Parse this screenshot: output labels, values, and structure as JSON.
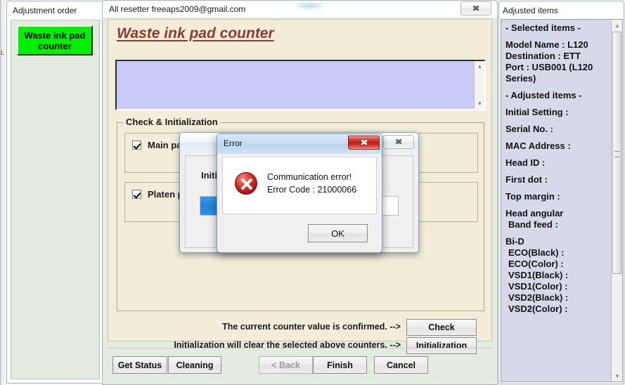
{
  "left_panel": {
    "title": "Adjustment order",
    "waste_button_label": "Waste ink pad counter",
    "waste_button_color": "#00f000",
    "edge_fragment": "L"
  },
  "main_window": {
    "title": "All resetter freeaps2009@gmail.com",
    "close_icon": "close-icon",
    "heading": "Waste ink pad counter",
    "heading_color": "#8f3b2e",
    "log_text": "",
    "group_label": "Check & Initialization",
    "checkboxes": [
      {
        "label": "Main pad counter",
        "checked": true
      },
      {
        "label": "Platen pad counter",
        "checked": true
      }
    ],
    "prompts": {
      "check": "The current counter value is confirmed. -->",
      "initialization": "Initialization will clear the selected above counters. -->"
    },
    "action_buttons": {
      "check": "Check",
      "initialization": "Initialization"
    },
    "footer_buttons": [
      {
        "label": "Get Status",
        "enabled": true
      },
      {
        "label": "Cleaning",
        "enabled": true
      },
      {
        "label": "< Back",
        "enabled": false
      },
      {
        "label": "Finish",
        "enabled": true
      },
      {
        "label": "Cancel",
        "enabled": true
      }
    ]
  },
  "init_dialog": {
    "text": "Initi",
    "close_icon": "close-icon",
    "progress_percent": 13
  },
  "error_dialog": {
    "title": "Error",
    "close_icon": "close-icon",
    "icon": "error-cross-icon",
    "message_line1": "Communication error!",
    "message_line2": "Error Code : 21000066",
    "ok_label": "OK"
  },
  "right_panel": {
    "title": "Adjusted items",
    "lines": [
      {
        "text": "- Selected items -",
        "type": "ln"
      },
      {
        "text": "",
        "type": "gap"
      },
      {
        "text": "Model Name : L120",
        "type": "ln"
      },
      {
        "text": "Destination : ETT",
        "type": "ln"
      },
      {
        "text": "Port : USB001 (L120",
        "type": "ln"
      },
      {
        "text": "Series)",
        "type": "ln"
      },
      {
        "text": "",
        "type": "gap"
      },
      {
        "text": "- Adjusted items -",
        "type": "ln"
      },
      {
        "text": "",
        "type": "gap"
      },
      {
        "text": "Initial Setting :",
        "type": "ln"
      },
      {
        "text": "",
        "type": "gap"
      },
      {
        "text": "Serial No. :",
        "type": "ln"
      },
      {
        "text": "",
        "type": "gap"
      },
      {
        "text": "MAC Address :",
        "type": "ln"
      },
      {
        "text": "",
        "type": "gap"
      },
      {
        "text": "Head ID :",
        "type": "ln"
      },
      {
        "text": "",
        "type": "gap"
      },
      {
        "text": "First dot :",
        "type": "ln"
      },
      {
        "text": "",
        "type": "gap"
      },
      {
        "text": "Top margin :",
        "type": "ln"
      },
      {
        "text": "",
        "type": "gap"
      },
      {
        "text": "Head angular",
        "type": "ln"
      },
      {
        "text": "Band feed :",
        "type": "sub"
      },
      {
        "text": "",
        "type": "gap"
      },
      {
        "text": "Bi-D",
        "type": "ln"
      },
      {
        "text": "ECO(Black)  :",
        "type": "sub"
      },
      {
        "text": "ECO(Color)  :",
        "type": "sub"
      },
      {
        "text": "VSD1(Black) :",
        "type": "sub"
      },
      {
        "text": "VSD1(Color) :",
        "type": "sub"
      },
      {
        "text": "VSD2(Black) :",
        "type": "sub"
      },
      {
        "text": "VSD2(Color) :",
        "type": "sub"
      }
    ]
  },
  "glyphs": {
    "close_x": "✖",
    "arrow_up": "▲",
    "arrow_down": "▼"
  }
}
